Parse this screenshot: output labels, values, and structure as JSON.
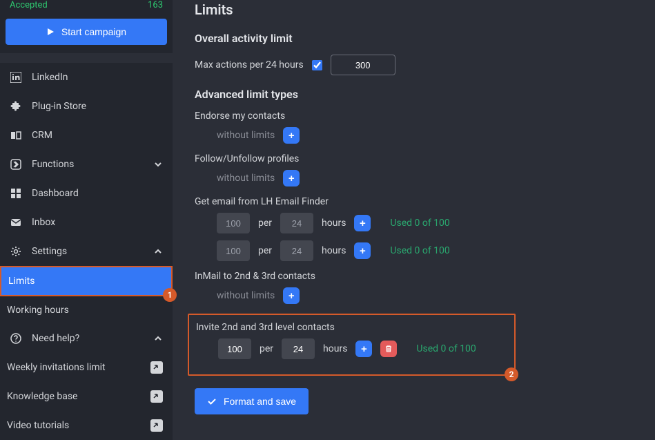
{
  "sidebar": {
    "accepted_label": "Accepted",
    "accepted_value": "163",
    "start_campaign": "Start campaign",
    "nav": {
      "linkedin": "LinkedIn",
      "plugin_store": "Plug-in Store",
      "crm": "CRM",
      "functions": "Functions",
      "dashboard": "Dashboard",
      "inbox": "Inbox",
      "settings": "Settings",
      "need_help": "Need help?"
    },
    "sub": {
      "limits": "Limits",
      "working_hours": "Working hours",
      "weekly_invitations": "Weekly invitations limit",
      "knowledge_base": "Knowledge base",
      "video_tutorials": "Video tutorials"
    }
  },
  "main": {
    "title": "Limits",
    "overall_heading": "Overall activity limit",
    "max_actions_label": "Max actions per 24 hours",
    "max_actions_value": "300",
    "advanced_heading": "Advanced limit types",
    "per_label": "per",
    "hours_label": "hours",
    "without_limits": "without limits",
    "groups": {
      "endorse": "Endorse my contacts",
      "follow": "Follow/Unfollow profiles",
      "get_email": "Get email from LH Email Finder",
      "inmail": "InMail to 2nd & 3rd contacts",
      "invite": "Invite 2nd and 3rd level contacts"
    },
    "email_rows": [
      {
        "count": "100",
        "hours": "24",
        "used": "Used 0 of 100"
      },
      {
        "count": "100",
        "hours": "24",
        "used": "Used 0 of 100"
      }
    ],
    "invite_row": {
      "count": "100",
      "hours": "24",
      "used": "Used 0 of 100"
    },
    "save_label": "Format and save"
  }
}
